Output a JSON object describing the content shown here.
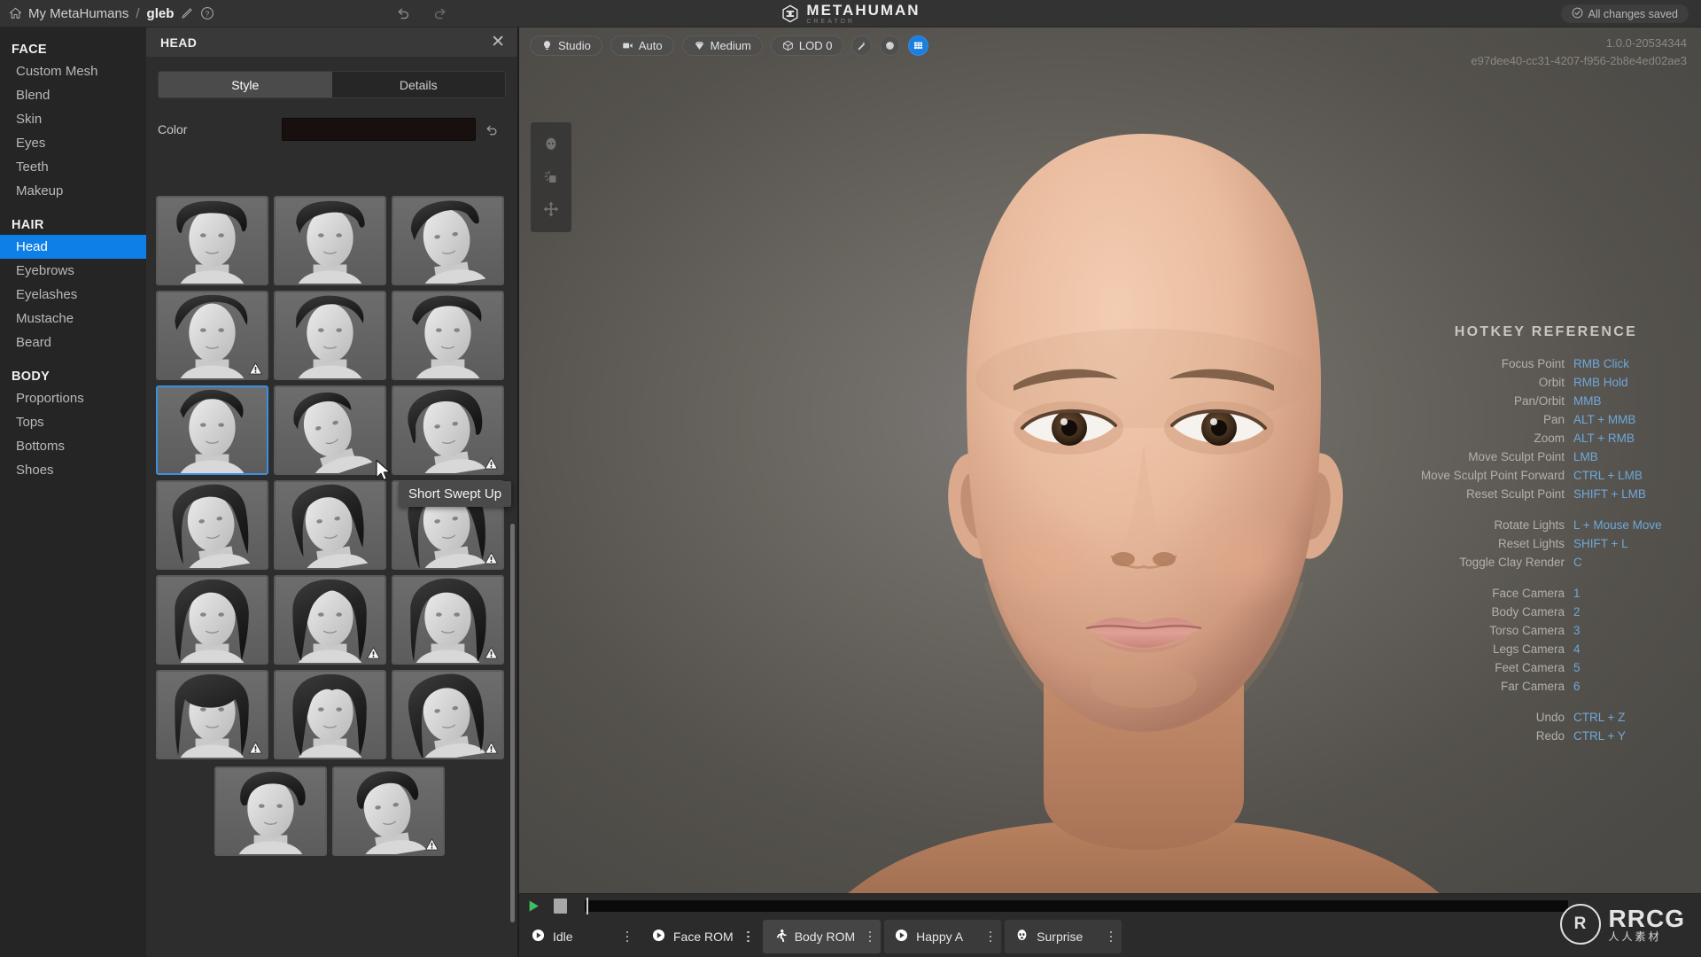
{
  "topbar": {
    "home_icon": "home-icon",
    "breadcrumb_root": "My MetaHumans",
    "breadcrumb_sep": "/",
    "breadcrumb_current": "gleb",
    "edit_icon": "pencil-icon",
    "help_icon": "help-circle-icon",
    "undo_icon": "undo-arrow-icon",
    "redo_icon": "redo-arrow-icon",
    "logo_title": "METAHUMAN",
    "logo_sub": "CREATOR",
    "save_status": "All changes saved",
    "save_icon": "check-circle-icon"
  },
  "sidebar": {
    "groups": [
      {
        "title": "FACE",
        "items": [
          {
            "label": "Custom Mesh",
            "active": false
          },
          {
            "label": "Blend",
            "active": false
          },
          {
            "label": "Skin",
            "active": false
          },
          {
            "label": "Eyes",
            "active": false
          },
          {
            "label": "Teeth",
            "active": false
          },
          {
            "label": "Makeup",
            "active": false
          }
        ]
      },
      {
        "title": "HAIR",
        "items": [
          {
            "label": "Head",
            "active": true
          },
          {
            "label": "Eyebrows",
            "active": false
          },
          {
            "label": "Eyelashes",
            "active": false
          },
          {
            "label": "Mustache",
            "active": false
          },
          {
            "label": "Beard",
            "active": false
          }
        ]
      },
      {
        "title": "BODY",
        "items": [
          {
            "label": "Proportions",
            "active": false
          },
          {
            "label": "Tops",
            "active": false
          },
          {
            "label": "Bottoms",
            "active": false
          },
          {
            "label": "Shoes",
            "active": false
          }
        ]
      }
    ]
  },
  "panel": {
    "title": "HEAD",
    "close_icon": "close-icon",
    "tabs": [
      {
        "label": "Style",
        "active": true
      },
      {
        "label": "Details",
        "active": false
      }
    ],
    "color_label": "Color",
    "color_value": "#18100e",
    "reset_icon": "undo-arrow-icon",
    "selected_index": 9,
    "tooltip": "Short Swept Up",
    "cursor_icon": "mouse-pointer-icon",
    "thumbnails": [
      {
        "index": 0,
        "warn": false,
        "pose": "front",
        "hair": "short-bob",
        "selected": false
      },
      {
        "index": 1,
        "warn": false,
        "pose": "front",
        "hair": "short-side",
        "selected": false
      },
      {
        "index": 2,
        "warn": false,
        "pose": "three-q",
        "hair": "short-swept",
        "selected": false
      },
      {
        "index": 3,
        "warn": true,
        "pose": "front",
        "hair": "messy-short",
        "selected": false
      },
      {
        "index": 4,
        "warn": false,
        "pose": "front",
        "hair": "textured-crop",
        "selected": false
      },
      {
        "index": 5,
        "warn": false,
        "pose": "front",
        "hair": "side-part",
        "selected": false
      },
      {
        "index": 6,
        "warn": false,
        "pose": "front",
        "hair": "short-swept-up",
        "selected": true
      },
      {
        "index": 7,
        "warn": false,
        "pose": "profile",
        "hair": "short-quiff",
        "selected": false
      },
      {
        "index": 8,
        "warn": true,
        "pose": "three-q",
        "hair": "medium-wavy",
        "selected": false
      },
      {
        "index": 9,
        "warn": false,
        "pose": "three-q",
        "hair": "long-straight",
        "selected": false
      },
      {
        "index": 10,
        "warn": false,
        "pose": "three-q",
        "hair": "shoulder-bob",
        "selected": false
      },
      {
        "index": 11,
        "warn": true,
        "pose": "three-q",
        "hair": "long-layered",
        "selected": false
      },
      {
        "index": 12,
        "warn": false,
        "pose": "front",
        "hair": "long-loose",
        "selected": false
      },
      {
        "index": 13,
        "warn": true,
        "pose": "front",
        "hair": "long-center",
        "selected": false
      },
      {
        "index": 14,
        "warn": true,
        "pose": "front",
        "hair": "very-long",
        "selected": false
      },
      {
        "index": 15,
        "warn": true,
        "pose": "front",
        "hair": "long-fringe",
        "selected": false
      },
      {
        "index": 16,
        "warn": false,
        "pose": "front",
        "hair": "long-parted",
        "selected": false
      },
      {
        "index": 17,
        "warn": true,
        "pose": "three-q",
        "hair": "long-side",
        "selected": false
      },
      {
        "index": 18,
        "warn": false,
        "pose": "front",
        "hair": "updo-bun",
        "selected": false
      },
      {
        "index": 19,
        "warn": true,
        "pose": "three-q",
        "hair": "updo-bun-side",
        "selected": false
      }
    ]
  },
  "viewport": {
    "toolbar": [
      {
        "name": "lighting-preset",
        "icon": "lightbulb-icon",
        "label": "Studio"
      },
      {
        "name": "camera-mode",
        "icon": "camera-icon",
        "label": "Auto"
      },
      {
        "name": "quality-preset",
        "icon": "diamond-icon",
        "label": "Medium"
      },
      {
        "name": "lod-level",
        "icon": "cube-icon",
        "label": "LOD 0"
      }
    ],
    "round_buttons": [
      {
        "name": "clay-render-toggle",
        "icon": "clay-icon",
        "on": false
      },
      {
        "name": "sphere-toggle",
        "icon": "sphere-icon",
        "on": false
      },
      {
        "name": "grid-toggle",
        "icon": "grid-icon",
        "on": true
      }
    ],
    "version": "1.0.0-20534344",
    "asset_id": "e97dee40-cc31-4207-f956-2b8e4ed02ae3",
    "side_tools": [
      {
        "name": "sculpt-head-tool",
        "icon": "head-icon"
      },
      {
        "name": "blend-tool",
        "icon": "sparkle-hand-icon"
      },
      {
        "name": "move-tool",
        "icon": "move-cross-icon"
      }
    ],
    "hotkeys": {
      "title": "HOTKEY REFERENCE",
      "groups": [
        [
          {
            "label": "Focus Point",
            "key": "RMB Click"
          },
          {
            "label": "Orbit",
            "key": "RMB Hold"
          },
          {
            "label": "Pan/Orbit",
            "key": "MMB"
          },
          {
            "label": "Pan",
            "key": "ALT + MMB"
          },
          {
            "label": "Zoom",
            "key": "ALT + RMB"
          },
          {
            "label": "Move Sculpt Point",
            "key": "LMB"
          },
          {
            "label": "Move Sculpt Point Forward",
            "key": "CTRL + LMB"
          },
          {
            "label": "Reset Sculpt Point",
            "key": "SHIFT + LMB"
          }
        ],
        [
          {
            "label": "Rotate Lights",
            "key": "L + Mouse Move"
          },
          {
            "label": "Reset Lights",
            "key": "SHIFT + L"
          },
          {
            "label": "Toggle Clay Render",
            "key": "C"
          }
        ],
        [
          {
            "label": "Face Camera",
            "key": "1"
          },
          {
            "label": "Body Camera",
            "key": "2"
          },
          {
            "label": "Torso Camera",
            "key": "3"
          },
          {
            "label": "Legs Camera",
            "key": "4"
          },
          {
            "label": "Feet Camera",
            "key": "5"
          },
          {
            "label": "Far Camera",
            "key": "6"
          }
        ],
        [
          {
            "label": "Undo",
            "key": "CTRL + Z"
          },
          {
            "label": "Redo",
            "key": "CTRL + Y"
          }
        ]
      ]
    }
  },
  "timeline": {
    "play_icon": "play-triangle-icon",
    "stop_icon": "stop-square-icon",
    "chips": [
      {
        "label": "Idle",
        "icon": "play-circle-icon",
        "style": "plain"
      },
      {
        "label": "Face ROM",
        "icon": "play-circle-icon",
        "style": "plain"
      },
      {
        "label": "Body ROM",
        "icon": "running-person-icon",
        "style": "alt"
      },
      {
        "label": "Happy A",
        "icon": "play-circle-icon",
        "style": "normal"
      },
      {
        "label": "Surprise",
        "icon": "face-icon",
        "style": "normal"
      }
    ],
    "menu_icon": "kebab-menu-icon"
  },
  "watermark": {
    "mark": "R",
    "main": "RRCG",
    "sub": "人人素材"
  },
  "colors": {
    "accent": "#0f7fe8",
    "hotkey_key": "#6ea8d8",
    "selection_border": "#3c8fe0"
  }
}
